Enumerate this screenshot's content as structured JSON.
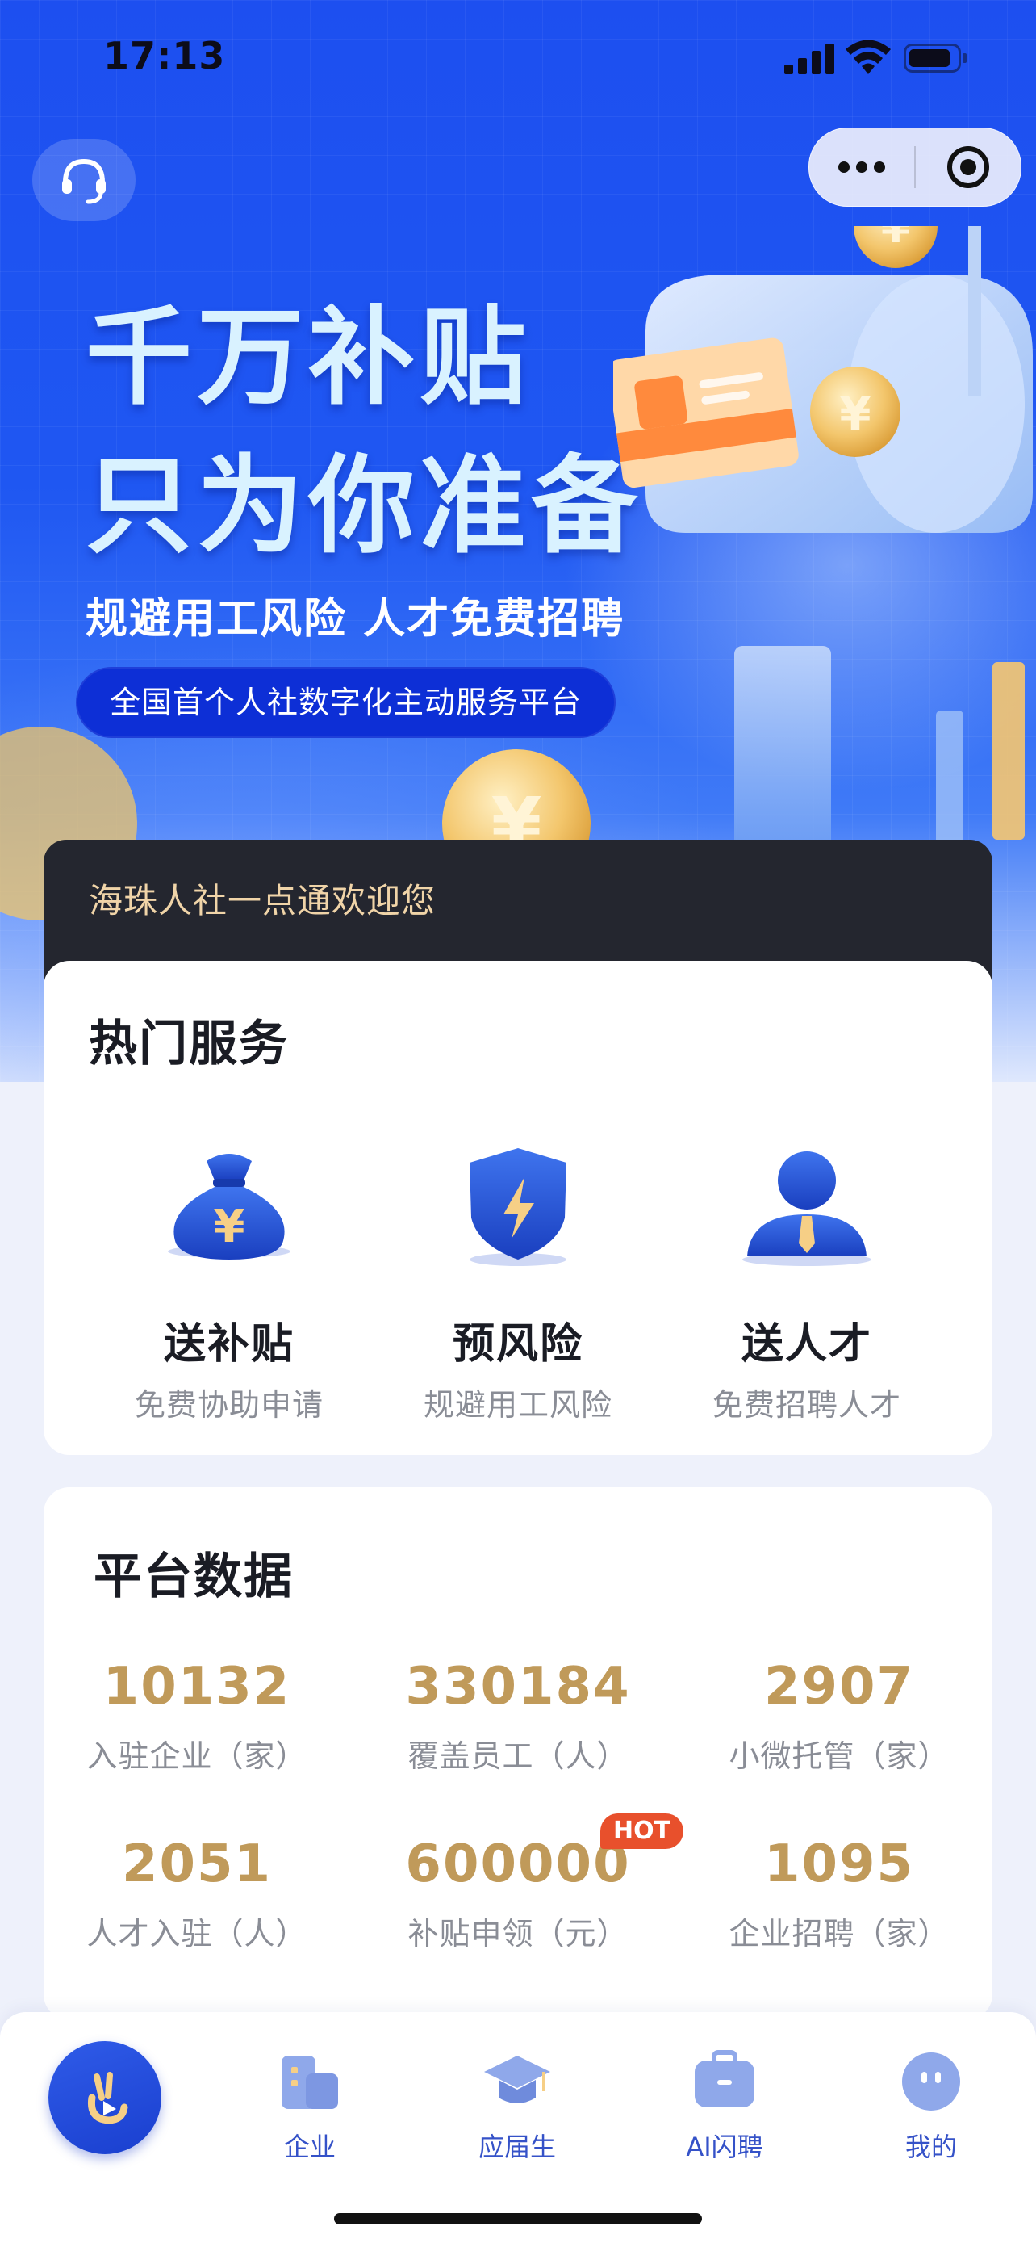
{
  "status_bar": {
    "time": "17:13"
  },
  "hero": {
    "headline_line1": "千万补贴",
    "headline_line2": "只为你准备",
    "subline": "规避用工风险 人才免费招聘",
    "pill": "全国首个人社数字化主动服务平台"
  },
  "welcome": {
    "text": "海珠人社一点通欢迎您"
  },
  "services": {
    "title": "热门服务",
    "items": [
      {
        "name": "送补贴",
        "desc": "免费协助申请",
        "icon": "money-bag-icon"
      },
      {
        "name": "预风险",
        "desc": "规避用工风险",
        "icon": "shield-lightning-icon"
      },
      {
        "name": "送人才",
        "desc": "免费招聘人才",
        "icon": "person-icon"
      }
    ]
  },
  "stats": {
    "title": "平台数据",
    "items": [
      {
        "value": "10132",
        "label": "入驻企业（家）"
      },
      {
        "value": "330184",
        "label": "覆盖员工（人）"
      },
      {
        "value": "2907",
        "label": "小微托管（家）"
      },
      {
        "value": "2051",
        "label": "人才入驻（人）"
      },
      {
        "value": "600000",
        "label": "补贴申领（元）"
      },
      {
        "value": "1095",
        "label": "企业招聘（家）"
      }
    ],
    "hot_badge": "HOT"
  },
  "tabbar": {
    "items": [
      {
        "label": "",
        "icon": "home-logo-icon"
      },
      {
        "label": "企业",
        "icon": "building-icon"
      },
      {
        "label": "应届生",
        "icon": "graduation-cap-icon"
      },
      {
        "label": "AI闪聘",
        "icon": "briefcase-icon"
      },
      {
        "label": "我的",
        "icon": "profile-face-icon"
      }
    ]
  },
  "colors": {
    "primary": "#1f57f2",
    "gold": "#c09a5a",
    "hot": "#e8502c",
    "dark_card": "#24262f",
    "tab_text": "#3552c8"
  }
}
